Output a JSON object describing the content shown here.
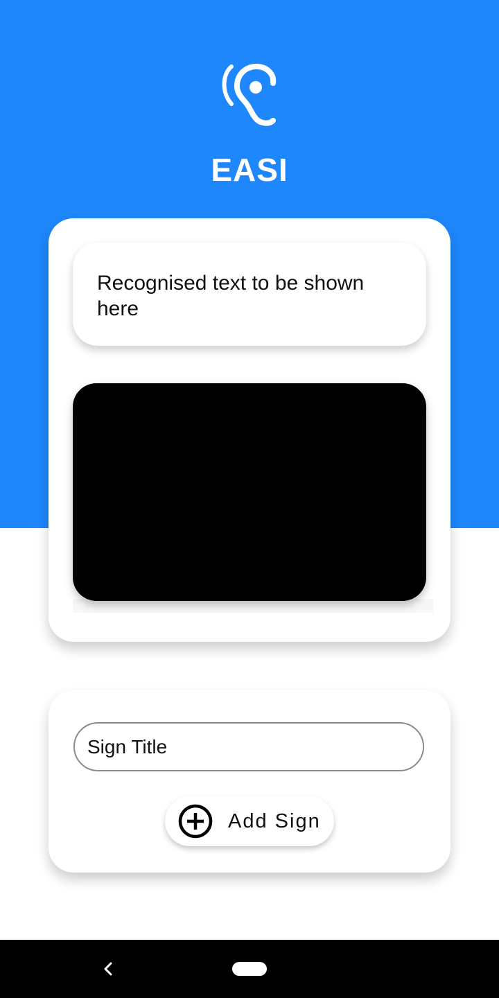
{
  "app": {
    "title": "EASI",
    "logo_icon": "ear-listening-icon",
    "brand_color": "#1e87fc"
  },
  "recognition": {
    "text": "Recognised text to be shown here"
  },
  "camera": {
    "preview_color": "#000000"
  },
  "add_sign": {
    "input_placeholder": "Sign Title",
    "button_label": "Add Sign",
    "button_icon": "plus-circle-icon"
  },
  "navigation": {
    "back_icon": "back-chevron-icon",
    "home_icon": "home-pill-icon"
  }
}
